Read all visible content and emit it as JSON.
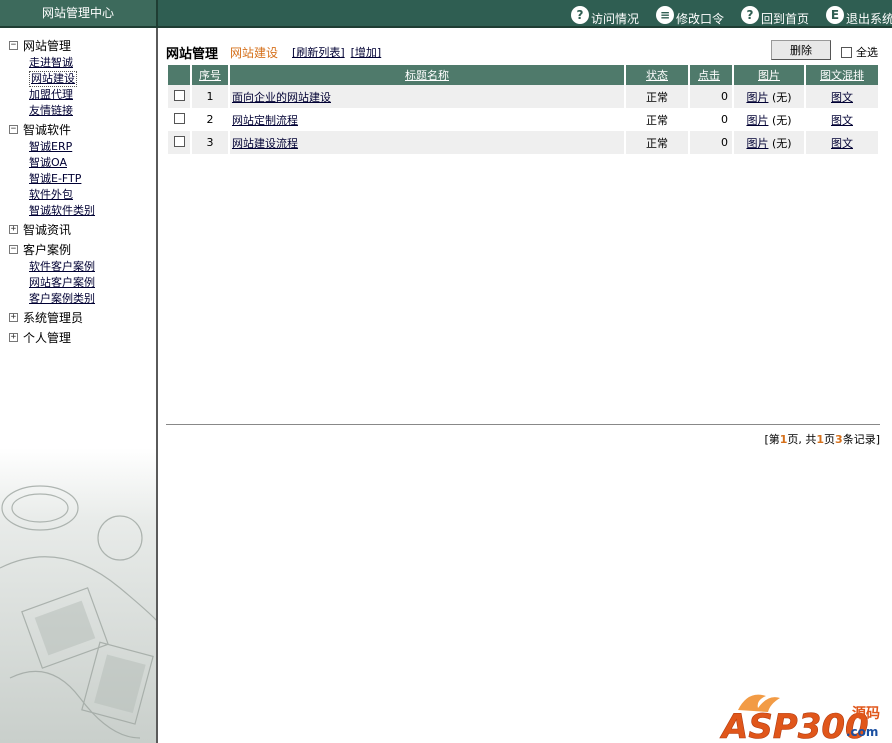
{
  "brand": "网站管理中心",
  "topnav": [
    {
      "label": "访问情况",
      "icon": "key-icon",
      "glyph": "?"
    },
    {
      "label": "修改口令",
      "icon": "document-icon",
      "glyph": "≡"
    },
    {
      "label": "回到首页",
      "icon": "key-icon",
      "glyph": "?"
    },
    {
      "label": "退出系统",
      "icon": "exit-icon",
      "glyph": "E"
    }
  ],
  "sidebar": {
    "groups": [
      {
        "label": "网站管理",
        "expanded": true,
        "toggle": "−",
        "items": [
          "走进智诚",
          "网站建设",
          "加盟代理",
          "友情链接"
        ],
        "active": "网站建设"
      },
      {
        "label": "智诚软件",
        "expanded": true,
        "toggle": "−",
        "items": [
          "智诚ERP",
          "智诚OA",
          "智诚E-FTP",
          "软件外包",
          "智诚软件类别"
        ]
      },
      {
        "label": "智诚资讯",
        "expanded": false,
        "toggle": "+",
        "items": []
      },
      {
        "label": "客户案例",
        "expanded": true,
        "toggle": "−",
        "items": [
          "软件客户案例",
          "网站客户案例",
          "客户案例类别"
        ]
      },
      {
        "label": "系统管理员",
        "expanded": false,
        "toggle": "+",
        "items": []
      },
      {
        "label": "个人管理",
        "expanded": false,
        "toggle": "+",
        "items": []
      }
    ]
  },
  "main": {
    "title": "网站管理",
    "section": "网站建设",
    "refresh_link": "[刷新列表]",
    "add_link": "[增加]",
    "delete_button": "删除",
    "select_all": "全选",
    "columns": [
      "序号",
      "标题名称",
      "状态",
      "点击",
      "图片",
      "图文混排"
    ],
    "rows": [
      {
        "no": "1",
        "title": "面向企业的网站建设",
        "status": "正常",
        "clicks": "0",
        "img": "图片",
        "img_state": "(无)",
        "mix": "图文"
      },
      {
        "no": "2",
        "title": "网站定制流程",
        "status": "正常",
        "clicks": "0",
        "img": "图片",
        "img_state": "(无)",
        "mix": "图文"
      },
      {
        "no": "3",
        "title": "网站建设流程",
        "status": "正常",
        "clicks": "0",
        "img": "图片",
        "img_state": "(无)",
        "mix": "图文"
      }
    ],
    "pager": {
      "prefix": "[第",
      "page": "1",
      "mid1": "页, 共",
      "pages": "1",
      "mid2": "页",
      "records": "3",
      "suffix": "条记录]"
    }
  },
  "watermark": {
    "text": "ASP300",
    "suffix": "源码",
    "domain": ".com"
  },
  "colors": {
    "header_bg": "#2f5e52",
    "table_head": "#4f7a6b",
    "accent": "#d5701b"
  }
}
